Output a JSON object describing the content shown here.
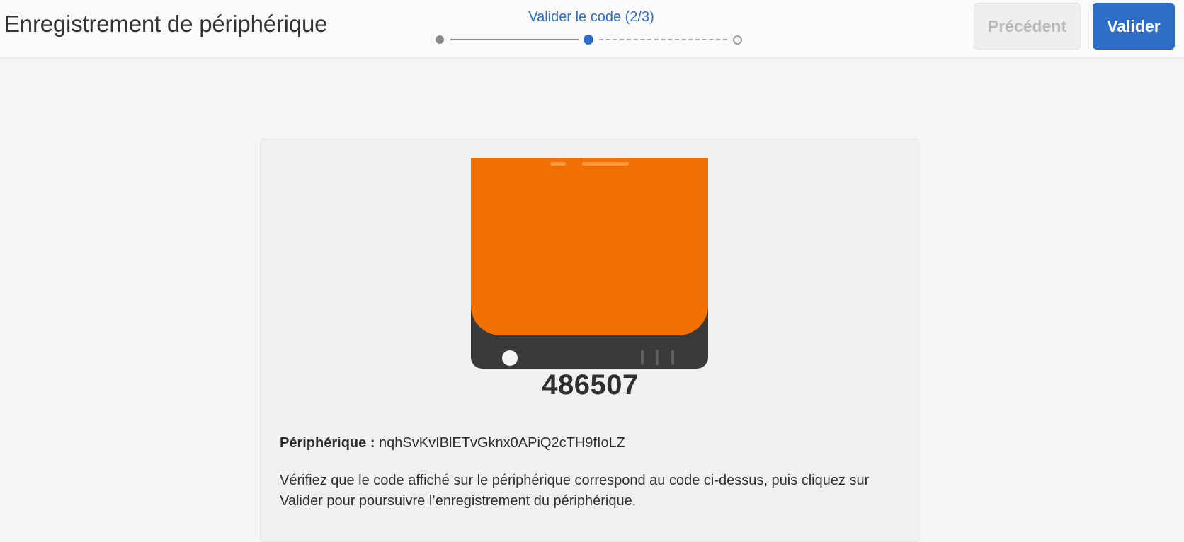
{
  "header": {
    "title": "Enregistrement de périphérique",
    "stepper": {
      "label": "Valider le code (2/3)",
      "current_step": 2,
      "total_steps": 3
    },
    "prev_label": "Précédent",
    "next_label": "Valider"
  },
  "card": {
    "code": "486507",
    "device_label": "Périphérique :",
    "device_id": "nqhSvKvIBlETvGknx0APiQ2cTH9fIoLZ",
    "instructions": "Vérifiez que le code affiché sur le périphérique correspond au code ci-dessus, puis cliquez sur Valider pour poursuivre l’enregistrement du périphérique."
  },
  "colors": {
    "accent": "#2d6ec9",
    "device_screen": "#f07003",
    "device_body": "#3a3a3a"
  },
  "icons": [
    "device-illustration"
  ]
}
